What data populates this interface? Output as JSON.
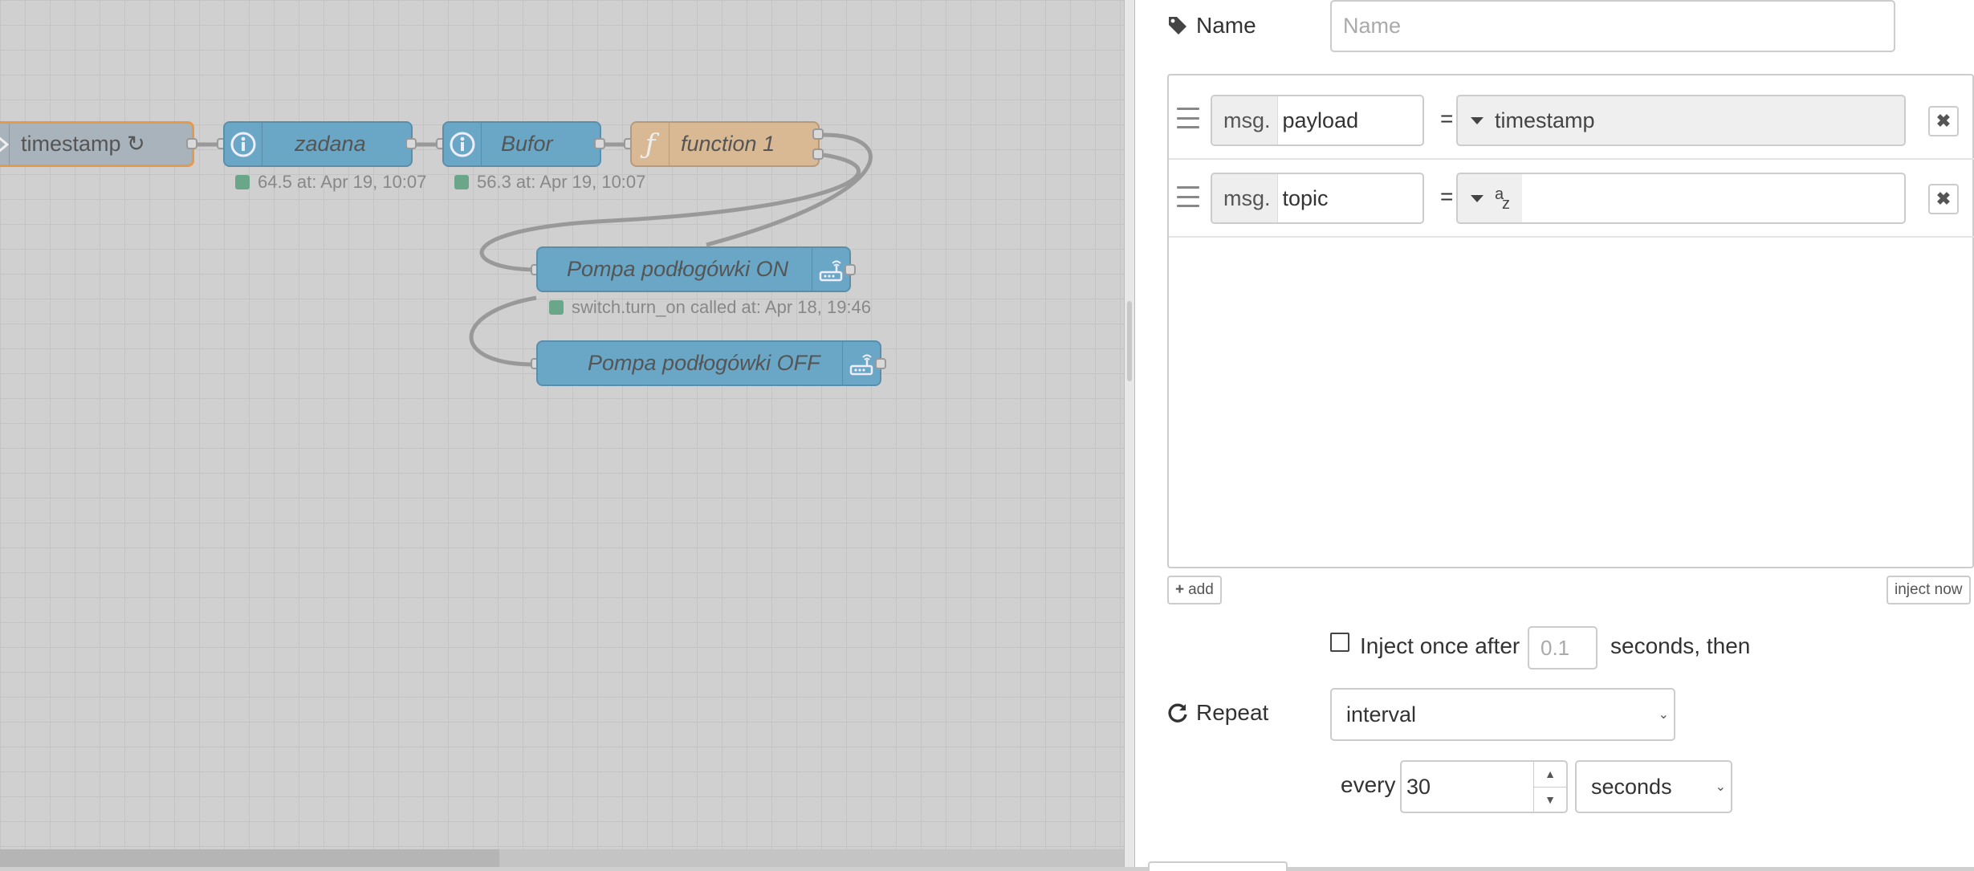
{
  "workspace": {
    "nodes": {
      "timestamp": {
        "label": "timestamp ↻"
      },
      "zadana": {
        "label": "zadana",
        "status": "64.5 at: Apr 19, 10:07"
      },
      "bufor": {
        "label": "Bufor",
        "status": "56.3 at: Apr 19, 10:07"
      },
      "function1": {
        "label": "function 1",
        "icon": "ƒ"
      },
      "pompa_on": {
        "label": "Pompa podłogówki ON",
        "status": "switch.turn_on called at: Apr 18, 19:46"
      },
      "pompa_off": {
        "label": "Pompa podłogówki OFF"
      }
    },
    "colors": {
      "debug_node": "#6aa7c6",
      "function_node": "#d9b993",
      "inject_node": "#a9b3bb",
      "selected_outline": "#e49a4a",
      "status_ok": "#6aa78a"
    }
  },
  "editor": {
    "name": {
      "label": "Name",
      "placeholder": "Name",
      "value": ""
    },
    "props": [
      {
        "prefix": "msg.",
        "property": "payload",
        "equals": "=",
        "type_label": "timestamp",
        "value": ""
      },
      {
        "prefix": "msg.",
        "property": "topic",
        "equals": "=",
        "type_icon": "az",
        "value": ""
      }
    ],
    "add_label": "add",
    "inject_now_label": "inject now",
    "inject_once": {
      "label": "Inject once after",
      "value": "0.1",
      "suffix": "seconds, then",
      "checked": false
    },
    "repeat": {
      "label": "Repeat",
      "value": "interval"
    },
    "every": {
      "label": "every",
      "value": "30",
      "unit": "seconds"
    }
  }
}
